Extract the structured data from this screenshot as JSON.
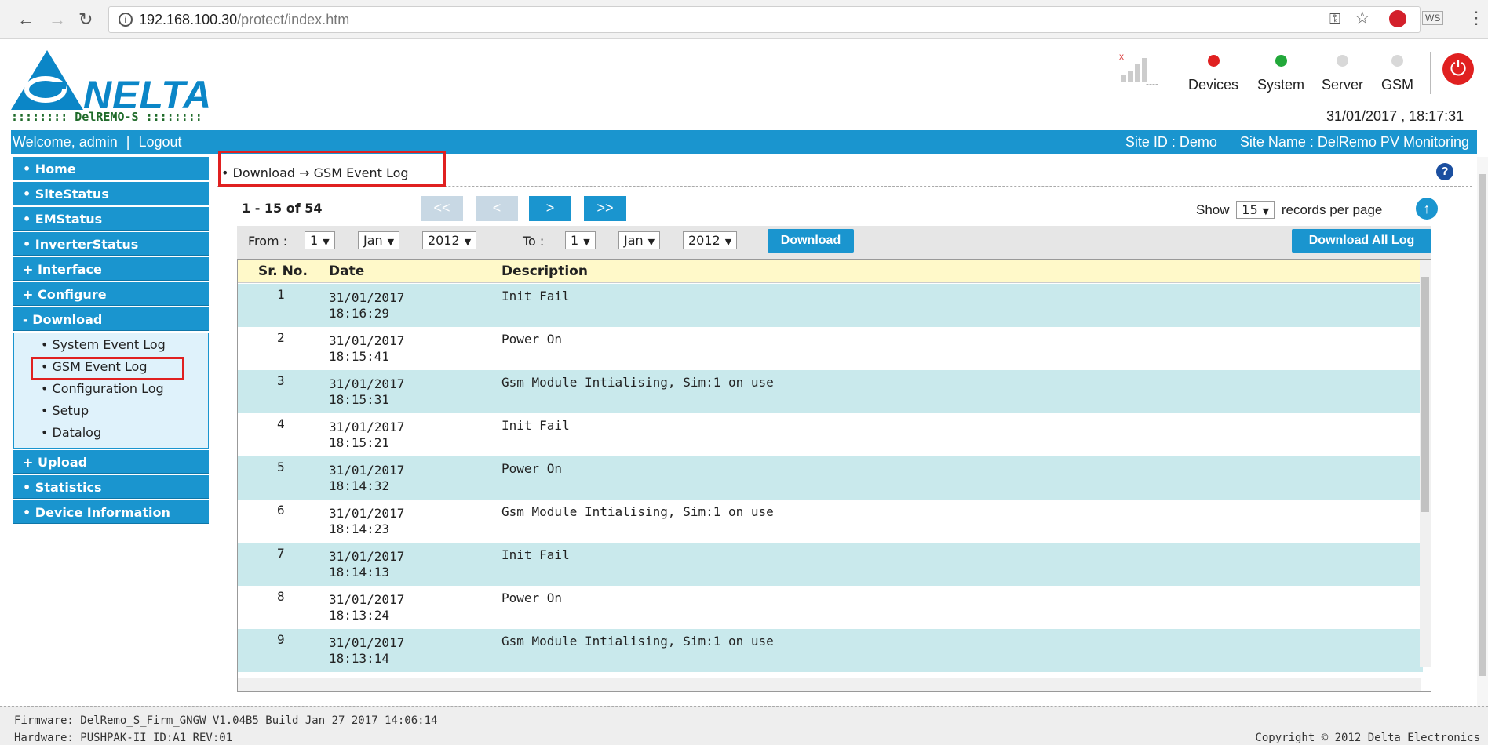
{
  "browser": {
    "url_host": "192.168.100.30",
    "url_path": "/protect/index.htm"
  },
  "header": {
    "brand": "NELTA",
    "sub_brand": ":::::::: DelREMO-S ::::::::",
    "status": [
      {
        "label": "Devices",
        "color": "#e02020"
      },
      {
        "label": "System",
        "color": "#22a83a"
      },
      {
        "label": "Server",
        "color": "#d8d8d8"
      },
      {
        "label": "GSM",
        "color": "#d8d8d8"
      }
    ],
    "signal_text": "----",
    "datetime": "31/01/2017 ,  18:17:31"
  },
  "topbar": {
    "welcome": "Welcome, admin",
    "separator": "|",
    "logout": "Logout",
    "site_id": "Site ID : Demo",
    "site_name": "Site Name : DelRemo PV Monitoring"
  },
  "sidebar": {
    "items": [
      {
        "label": "• Home"
      },
      {
        "label": "• SiteStatus"
      },
      {
        "label": "• EMStatus"
      },
      {
        "label": "• InverterStatus"
      },
      {
        "label": "+ Interface"
      },
      {
        "label": "+ Configure"
      },
      {
        "label": "- Download"
      }
    ],
    "download_sub": [
      {
        "label": "• System Event Log"
      },
      {
        "label": "• GSM Event Log"
      },
      {
        "label": "• Configuration Log"
      },
      {
        "label": "• Setup"
      },
      {
        "label": "• Datalog"
      }
    ],
    "items_after": [
      {
        "label": "+ Upload"
      },
      {
        "label": "• Statistics"
      },
      {
        "label": "• Device Information"
      }
    ]
  },
  "breadcrumb": "•  Download → GSM Event Log",
  "pager": {
    "count": "1 - 15 of 54",
    "first": "<<",
    "prev": "<",
    "next": ">",
    "last": ">>",
    "show_label": "Show",
    "per_page": "15",
    "per_page_suffix": "records per page"
  },
  "filter": {
    "from_label": "From  :",
    "from_day": "1",
    "from_month": "Jan",
    "from_year": "2012",
    "to_label": "To  :",
    "to_day": "1",
    "to_month": "Jan",
    "to_year": "2012",
    "download": "Download",
    "download_all": "Download All Log"
  },
  "table": {
    "headers": [
      "Sr. No.",
      "Date",
      "Description"
    ],
    "rows": [
      {
        "sr": "1",
        "date": "31/01/2017",
        "time": "18:16:29",
        "desc": "Init Fail"
      },
      {
        "sr": "2",
        "date": "31/01/2017",
        "time": "18:15:41",
        "desc": "Power On"
      },
      {
        "sr": "3",
        "date": "31/01/2017",
        "time": "18:15:31",
        "desc": "Gsm Module Intialising, Sim:1 on use"
      },
      {
        "sr": "4",
        "date": "31/01/2017",
        "time": "18:15:21",
        "desc": "Init Fail"
      },
      {
        "sr": "5",
        "date": "31/01/2017",
        "time": "18:14:32",
        "desc": "Power On"
      },
      {
        "sr": "6",
        "date": "31/01/2017",
        "time": "18:14:23",
        "desc": "Gsm Module Intialising, Sim:1 on use"
      },
      {
        "sr": "7",
        "date": "31/01/2017",
        "time": "18:14:13",
        "desc": "Init Fail"
      },
      {
        "sr": "8",
        "date": "31/01/2017",
        "time": "18:13:24",
        "desc": "Power On"
      },
      {
        "sr": "9",
        "date": "31/01/2017",
        "time": "18:13:14",
        "desc": "Gsm Module Intialising, Sim:1 on use"
      }
    ]
  },
  "footer": {
    "firmware": "Firmware: DelRemo_S_Firm_GNGW V1.04B5 Build Jan 27 2017 14:06:14",
    "hardware": "Hardware: PUSHPAK-II ID:A1 REV:01",
    "copyright": "Copyright © 2012 Delta Electronics"
  }
}
